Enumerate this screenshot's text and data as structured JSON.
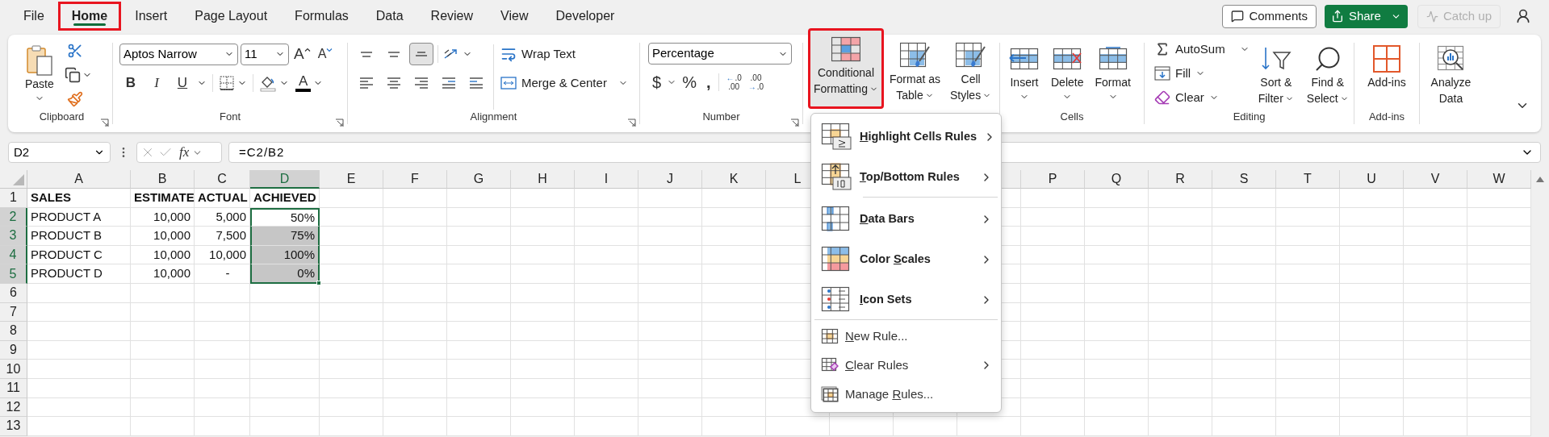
{
  "tabs": [
    {
      "label": "File",
      "selected": false,
      "outlined": false
    },
    {
      "label": "Home",
      "selected": true,
      "outlined": true
    },
    {
      "label": "Insert",
      "selected": false,
      "outlined": false
    },
    {
      "label": "Page Layout",
      "selected": false,
      "outlined": false
    },
    {
      "label": "Formulas",
      "selected": false,
      "outlined": false
    },
    {
      "label": "Data",
      "selected": false,
      "outlined": false
    },
    {
      "label": "Review",
      "selected": false,
      "outlined": false
    },
    {
      "label": "View",
      "selected": false,
      "outlined": false
    },
    {
      "label": "Developer",
      "selected": false,
      "outlined": false
    }
  ],
  "top_buttons": {
    "comments": "Comments",
    "share": "Share",
    "catch_up": {
      "label": "Catch up",
      "disabled": true
    }
  },
  "ribbon": {
    "clipboard": {
      "label": "Clipboard",
      "paste": "Paste"
    },
    "font": {
      "label": "Font",
      "font_name": "Aptos Narrow",
      "font_size": "11",
      "grow_font": "A",
      "shrink_font": "A",
      "font_color": "A",
      "format_buttons": [
        {
          "kind": "bold",
          "label": "B"
        },
        {
          "kind": "italic",
          "label": "I"
        },
        {
          "kind": "underline",
          "label": "U"
        }
      ]
    },
    "alignment": {
      "label": "Alignment",
      "wrap_text": "Wrap Text",
      "merge": "Merge & Center",
      "vertical_align_buttons": [
        {
          "selected": false
        },
        {
          "selected": false
        },
        {
          "selected": true
        }
      ]
    },
    "number": {
      "label": "Number",
      "format": "Percentage",
      "symbols": [
        "$",
        "%",
        ","
      ],
      "decimal_buttons": [
        {
          "arrow": "←",
          "top": ".0",
          "bottom": ".00"
        },
        {
          "arrow": "→",
          "top": ".00",
          "bottom": ".0"
        }
      ]
    },
    "styles": {
      "buttons": [
        {
          "lines": [
            "Conditional",
            "Formatting"
          ],
          "pressed": true,
          "outlined": true
        },
        {
          "lines": [
            "Format as",
            "Table"
          ],
          "pressed": false,
          "outlined": false
        },
        {
          "lines": [
            "Cell",
            "Styles"
          ],
          "pressed": false,
          "outlined": false
        }
      ]
    },
    "cells": {
      "label": "Cells",
      "buttons": [
        "Insert",
        "Delete",
        "Format"
      ]
    },
    "editing": {
      "label": "Editing",
      "autosum": "AutoSum",
      "fill": "Fill",
      "clear": "Clear",
      "sort": [
        "Sort &",
        "Filter"
      ],
      "find": [
        "Find &",
        "Select"
      ]
    },
    "addins": {
      "label": "Add-ins",
      "button": "Add-ins"
    },
    "analysis": {
      "lines": [
        "Analyze",
        "Data"
      ]
    }
  },
  "formula_bar": {
    "name_box": "D2",
    "fx": "fx",
    "formula": "=C2/B2"
  },
  "sheet": {
    "columns_left": [
      {
        "label": "A",
        "selected": false
      },
      {
        "label": "B",
        "selected": false
      },
      {
        "label": "C",
        "selected": false
      },
      {
        "label": "D",
        "selected": true
      },
      {
        "label": "E",
        "selected": false
      },
      {
        "label": "F",
        "selected": false
      },
      {
        "label": "G",
        "selected": false
      },
      {
        "label": "H",
        "selected": false
      },
      {
        "label": "I",
        "selected": false
      },
      {
        "label": "J",
        "selected": false
      },
      {
        "label": "K",
        "selected": false
      },
      {
        "label": "L",
        "selected": false
      }
    ],
    "columns_right": [
      {
        "label": "P",
        "selected": false
      },
      {
        "label": "Q",
        "selected": false
      },
      {
        "label": "R",
        "selected": false
      },
      {
        "label": "S",
        "selected": false
      },
      {
        "label": "T",
        "selected": false
      },
      {
        "label": "U",
        "selected": false
      },
      {
        "label": "V",
        "selected": false
      },
      {
        "label": "W",
        "selected": false
      }
    ],
    "rows": [
      {
        "label": "1",
        "selected": false,
        "bold": true,
        "cells": [
          {
            "text": "SALES",
            "kind": "text",
            "selected": false,
            "active": false
          },
          {
            "text": "ESTIMATE",
            "kind": "text",
            "selected": false,
            "active": false
          },
          {
            "text": "ACTUAL",
            "kind": "text",
            "selected": false,
            "active": false
          },
          {
            "text": "ACHIEVED",
            "kind": "text",
            "selected": false,
            "active": false
          }
        ]
      },
      {
        "label": "2",
        "selected": true,
        "bold": false,
        "cells": [
          {
            "text": "PRODUCT A",
            "kind": "text",
            "selected": false,
            "active": false
          },
          {
            "text": "10,000",
            "kind": "number",
            "selected": false,
            "active": false
          },
          {
            "text": "5,000",
            "kind": "number",
            "selected": false,
            "active": false
          },
          {
            "text": "50%",
            "kind": "number",
            "selected": true,
            "active": true
          }
        ]
      },
      {
        "label": "3",
        "selected": true,
        "bold": false,
        "cells": [
          {
            "text": "PRODUCT B",
            "kind": "text",
            "selected": false,
            "active": false
          },
          {
            "text": "10,000",
            "kind": "number",
            "selected": false,
            "active": false
          },
          {
            "text": "7,500",
            "kind": "number",
            "selected": false,
            "active": false
          },
          {
            "text": "75%",
            "kind": "number",
            "selected": true,
            "active": false
          }
        ]
      },
      {
        "label": "4",
        "selected": true,
        "bold": false,
        "cells": [
          {
            "text": "PRODUCT C",
            "kind": "text",
            "selected": false,
            "active": false
          },
          {
            "text": "10,000",
            "kind": "number",
            "selected": false,
            "active": false
          },
          {
            "text": "10,000",
            "kind": "number",
            "selected": false,
            "active": false
          },
          {
            "text": "100%",
            "kind": "number",
            "selected": true,
            "active": false
          }
        ]
      },
      {
        "label": "5",
        "selected": true,
        "bold": false,
        "cells": [
          {
            "text": "PRODUCT D",
            "kind": "text",
            "selected": false,
            "active": false
          },
          {
            "text": "10,000",
            "kind": "number",
            "selected": false,
            "active": false
          },
          {
            "text": "-",
            "kind": "dash",
            "selected": false,
            "active": false
          },
          {
            "text": "0%",
            "kind": "number",
            "selected": true,
            "active": false
          }
        ]
      },
      {
        "label": "6",
        "selected": false,
        "cells": []
      },
      {
        "label": "7",
        "selected": false,
        "cells": []
      },
      {
        "label": "8",
        "selected": false,
        "cells": []
      },
      {
        "label": "9",
        "selected": false,
        "cells": []
      },
      {
        "label": "10",
        "selected": false,
        "cells": []
      },
      {
        "label": "11",
        "selected": false,
        "cells": []
      },
      {
        "label": "12",
        "selected": false,
        "cells": []
      },
      {
        "label": "13",
        "selected": false,
        "cells": []
      }
    ]
  },
  "menu": {
    "items": [
      {
        "kind": "large",
        "label": {
          "key": "H",
          "after": "ighlight Cells Rules"
        },
        "submenu": true,
        "separator_after": false
      },
      {
        "kind": "large",
        "label": {
          "key": "T",
          "after": "op/Bottom Rules"
        },
        "submenu": true,
        "separator_after": true
      },
      {
        "kind": "large",
        "label": {
          "key": "D",
          "after": "ata Bars"
        },
        "submenu": true,
        "separator_after": false
      },
      {
        "kind": "large",
        "label": {
          "before": "Color ",
          "key": "S",
          "after": "cales"
        },
        "submenu": true,
        "separator_after": false
      },
      {
        "kind": "large",
        "label": {
          "key": "I",
          "after": "con Sets"
        },
        "submenu": true,
        "separator_after": true
      },
      {
        "kind": "small",
        "label": {
          "key": "N",
          "after": "ew Rule..."
        },
        "submenu": false,
        "separator_after": false
      },
      {
        "kind": "small",
        "label": {
          "key": "C",
          "after": "lear Rules"
        },
        "submenu": true,
        "separator_after": false
      },
      {
        "kind": "small",
        "label": {
          "before": "Manage ",
          "key": "R",
          "after": "ules..."
        },
        "submenu": false,
        "separator_after": false
      }
    ]
  }
}
